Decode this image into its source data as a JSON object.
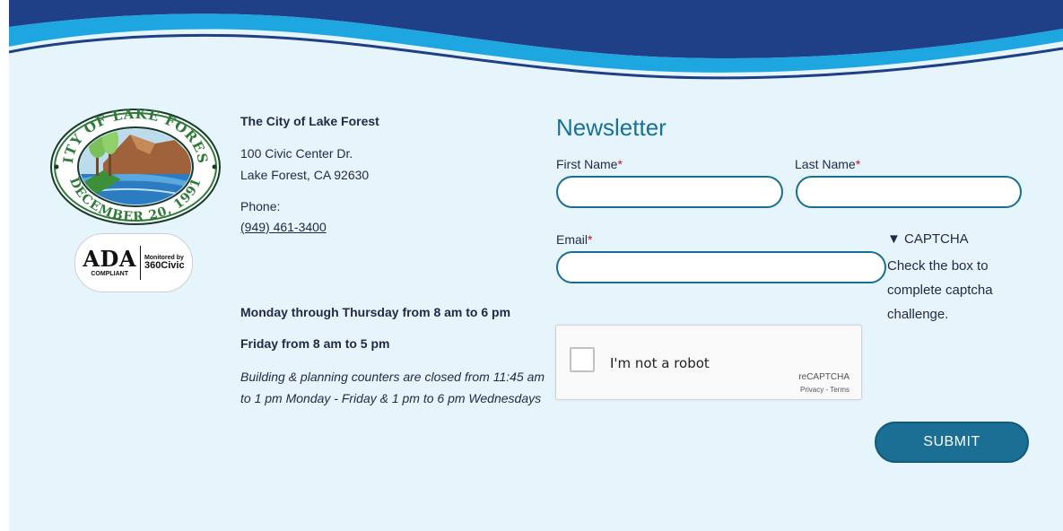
{
  "colors": {
    "page_bg": "#e6f4fb",
    "wave_dark": "#1f3f86",
    "wave_light": "#1ea6e0",
    "accent": "#1b6e94",
    "required": "#c0142b"
  },
  "logo": {
    "seal_top_text": "CITY OF LAKE FOREST",
    "seal_bottom_text": "DECEMBER 20, 1991"
  },
  "ada_badge": {
    "main": "ADA",
    "compliant": "COMPLIANT",
    "monitored": "Monitored by",
    "brand": "360Civic"
  },
  "contact": {
    "org_name": "The City of Lake Forest",
    "street": "100 Civic Center Dr.",
    "city_state": "Lake Forest, CA 92630",
    "phone_label": "Phone:",
    "phone": "(949) 461-3400"
  },
  "hours": {
    "line1": "Monday through Thursday from 8 am to 6 pm",
    "line2": "Friday from 8 am to 5 pm",
    "note": "Building & planning counters are closed from 11:45 am to 1 pm Monday - Friday & 1 pm to 6 pm Wednesdays"
  },
  "newsletter": {
    "title": "Newsletter",
    "first_name_label": "First Name",
    "last_name_label": "Last Name",
    "email_label": "Email",
    "required_mark": "*",
    "first_name_value": "",
    "last_name_value": "",
    "email_value": "",
    "captcha_toggle": "▼ CAPTCHA",
    "captcha_help": "Check the box to complete captcha challenge.",
    "submit_label": "SUBMIT"
  },
  "recaptcha": {
    "label": "I'm not a robot",
    "brand": "reCAPTCHA",
    "privacy": "Privacy",
    "separator": " - ",
    "terms": "Terms"
  }
}
